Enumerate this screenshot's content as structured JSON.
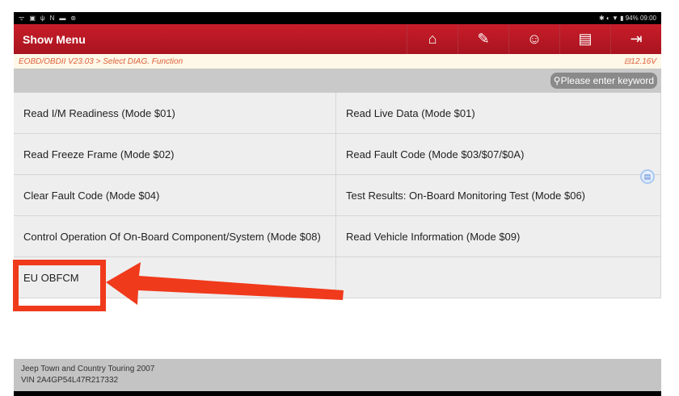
{
  "status": {
    "battery": "94%",
    "time": "09:00"
  },
  "header": {
    "title": "Show Menu",
    "tools": [
      "home-icon",
      "edit-report-icon",
      "support-icon",
      "print-icon",
      "exit-icon"
    ]
  },
  "breadcrumb": {
    "path": "EOBD/OBDII V23.03 > Select DIAG. Function",
    "voltage": "12.16V"
  },
  "search": {
    "placeholder": "Please enter keyword"
  },
  "menu": [
    "Read I/M Readiness (Mode $01)",
    "Read Live Data (Mode $01)",
    "Read Freeze Frame (Mode $02)",
    "Read Fault Code (Mode $03/$07/$0A)",
    "Clear Fault Code (Mode $04)",
    "Test Results: On-Board Monitoring Test (Mode $06)",
    "Control Operation Of On-Board Component/System (Mode $08)",
    "Read Vehicle Information (Mode $09)",
    "EU OBFCM",
    ""
  ],
  "footer": {
    "vehicle": "Jeep Town and Country Touring 2007",
    "vin": "VIN 2A4GP54L47R217332"
  },
  "annotation_color": "#f03a1c"
}
